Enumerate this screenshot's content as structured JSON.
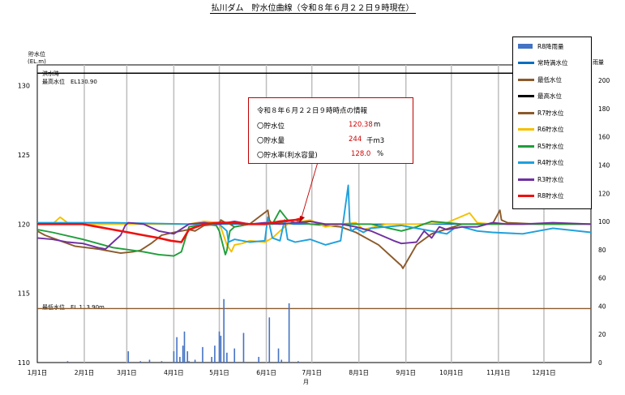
{
  "title": "払川ダム　貯水位曲線（令和８年６月２２日９時現在）",
  "axes": {
    "left_label_1": "貯水位",
    "left_label_2": "(EL.m)",
    "right_label": "雨量",
    "x_unit": "月"
  },
  "annotations": {
    "flood_label_1": "洪水時",
    "flood_label_2": "最高水位　EL130.90",
    "low_label": "最低水位　EL.113.90m"
  },
  "info_box": {
    "heading": "令和８年６月２２日９時時点の情報",
    "level_label": "〇貯水位",
    "level_value": "120.38",
    "level_unit": "m",
    "volume_label": "〇貯水量",
    "volume_value": "244",
    "volume_unit": "千m3",
    "rate_label": "〇貯水率(利水容量)",
    "rate_value": "128.0",
    "rate_unit": "%"
  },
  "legend": [
    {
      "label": "R8降雨量",
      "color": "#4472c4",
      "kind": "bar"
    },
    {
      "label": "常時満水位",
      "color": "#0070c0",
      "kind": "line"
    },
    {
      "label": "最低水位",
      "color": "#8b5a2b",
      "kind": "line"
    },
    {
      "label": "最高水位",
      "color": "#000000",
      "kind": "line"
    },
    {
      "label": "R7貯水位",
      "color": "#8b5a2b",
      "kind": "line"
    },
    {
      "label": "R6貯水位",
      "color": "#f5c000",
      "kind": "line"
    },
    {
      "label": "R5貯水位",
      "color": "#1e9e3a",
      "kind": "line"
    },
    {
      "label": "R4貯水位",
      "color": "#1ea0dc",
      "kind": "line"
    },
    {
      "label": "R3貯水位",
      "color": "#7030a0",
      "kind": "line"
    },
    {
      "label": "R8貯水位",
      "color": "#ee1010",
      "kind": "line"
    }
  ],
  "chart_data": {
    "type": "line",
    "xlabel": "月",
    "categories": [
      "1月1日",
      "2月1日",
      "3月1日",
      "4月1日",
      "5月1日",
      "6月1日",
      "7月1日",
      "8月1日",
      "9月1日",
      "10月1日",
      "11月1日",
      "12月1日"
    ],
    "y_left": {
      "label": "貯水位 (EL.m)",
      "ticks": [
        110,
        115,
        120,
        125,
        130
      ],
      "range": [
        110,
        131.5
      ]
    },
    "y_right": {
      "label": "雨量",
      "ticks": [
        0,
        20,
        40,
        60,
        80,
        100,
        120,
        140,
        160,
        180,
        200
      ],
      "range": [
        0,
        211
      ]
    },
    "grid": true,
    "legend_position": "top-right",
    "reference_lines": [
      {
        "name": "最高水位",
        "value": 130.9
      },
      {
        "name": "常時満水位",
        "value": 120.0
      },
      {
        "name": "最低水位",
        "value": 113.9
      }
    ],
    "series": [
      {
        "name": "R7貯水位",
        "x": [
          0,
          5,
          15,
          25,
          40,
          55,
          63,
          68,
          75,
          82,
          90,
          100,
          104,
          110,
          120,
          121,
          124,
          127,
          130,
          140,
          152,
          153,
          155,
          160,
          170,
          180,
          200,
          210,
          225,
          235,
          240,
          241,
          250,
          260,
          280,
          300,
          305,
          306,
          310,
          330,
          365
        ],
        "y": [
          119.5,
          119.2,
          118.8,
          118.4,
          118.2,
          117.9,
          118,
          118.1,
          118.6,
          119.2,
          119.4,
          119.6,
          119.5,
          119.9,
          120,
          120.3,
          120.1,
          120,
          119.8,
          120,
          121,
          120.3,
          120,
          120.1,
          120.3,
          120,
          119.8,
          119.4,
          118.5,
          117.5,
          117,
          116.8,
          118.5,
          119.3,
          120,
          120,
          121,
          120.3,
          120.1,
          120,
          120
        ]
      },
      {
        "name": "R6貯水位",
        "x": [
          0,
          10,
          15,
          20,
          30,
          60,
          100,
          110,
          120,
          125,
          128,
          130,
          135,
          140,
          150,
          155,
          165,
          170,
          180,
          190,
          200,
          210,
          215,
          230,
          250,
          270,
          285,
          290,
          300,
          320,
          340,
          365
        ],
        "y": [
          120,
          120,
          120.5,
          120.1,
          120,
          120,
          120,
          120.2,
          120.1,
          118.5,
          118,
          118.5,
          118.6,
          118.8,
          118.7,
          119,
          120,
          120.1,
          120.3,
          119.8,
          120,
          120.1,
          119.6,
          120,
          120,
          120.1,
          120.8,
          120.1,
          120,
          120,
          120,
          120
        ]
      },
      {
        "name": "R5貯水位",
        "x": [
          0,
          10,
          30,
          50,
          70,
          80,
          90,
          95,
          100,
          110,
          118,
          120,
          124,
          125,
          127,
          130,
          140,
          155,
          160,
          165,
          170,
          180,
          200,
          220,
          240,
          250,
          260,
          280,
          300,
          320,
          340,
          365
        ],
        "y": [
          119.6,
          119.4,
          118.9,
          118.3,
          118,
          117.8,
          117.7,
          118,
          119.8,
          120,
          119.9,
          119.5,
          117.8,
          118.1,
          119.5,
          119.8,
          120,
          120,
          121,
          120.3,
          120.1,
          120,
          120,
          120,
          119.5,
          119.8,
          120.2,
          120,
          120,
          120,
          120,
          120
        ]
      },
      {
        "name": "R4貯水位",
        "x": [
          0,
          50,
          100,
          120,
          125,
          126,
          130,
          140,
          150,
          152,
          155,
          160,
          163,
          165,
          170,
          180,
          190,
          200,
          205,
          206,
          207,
          210,
          215,
          220,
          230,
          240,
          250,
          270,
          275,
          280,
          290,
          300,
          320,
          340,
          365
        ],
        "y": [
          120.1,
          120.1,
          120,
          120,
          119.5,
          118.7,
          118.9,
          118.7,
          118.8,
          120.5,
          119,
          118.8,
          120.3,
          118.9,
          118.7,
          118.9,
          118.5,
          118.8,
          122.8,
          120,
          119.5,
          119.7,
          119.4,
          119.7,
          119.8,
          119.9,
          119.7,
          119.3,
          119.7,
          119.8,
          119.5,
          119.4,
          119.3,
          119.7,
          119.4
        ]
      },
      {
        "name": "R3貯水位",
        "x": [
          0,
          10,
          20,
          30,
          40,
          45,
          55,
          58,
          60,
          70,
          80,
          90,
          100,
          110,
          120,
          125,
          130,
          140,
          150,
          160,
          170,
          180,
          190,
          200,
          210,
          220,
          235,
          240,
          250,
          255,
          260,
          265,
          270,
          280,
          290,
          300,
          310,
          320,
          340,
          365
        ],
        "y": [
          119,
          118.9,
          118.7,
          118.6,
          118.3,
          118.2,
          119.2,
          119.9,
          120.1,
          120,
          119.5,
          119.3,
          120,
          120.1,
          120,
          120.1,
          120.2,
          120,
          120.1,
          120,
          120.1,
          120.2,
          120,
          120,
          119.8,
          119.5,
          118.8,
          118.6,
          118.7,
          119.5,
          119,
          119.8,
          119.6,
          119.8,
          119.8,
          120.1,
          120,
          120,
          120.1,
          120
        ]
      },
      {
        "name": "R8貯水位",
        "x": [
          0,
          10,
          20,
          30,
          40,
          50,
          60,
          70,
          80,
          88,
          95,
          100,
          110,
          120,
          130,
          140,
          150,
          160,
          170,
          173
        ],
        "y": [
          120,
          120,
          120,
          120,
          119.8,
          119.6,
          119.4,
          119.2,
          119,
          118.8,
          118.7,
          119.6,
          120,
          120.1,
          120.1,
          120,
          120,
          120.2,
          120.3,
          120.38
        ]
      },
      {
        "name": "R8降雨量",
        "kind": "bar",
        "x": [
          20,
          60,
          68,
          74,
          82,
          90,
          92,
          94,
          96,
          97,
          99,
          100,
          104,
          109,
          115,
          117,
          120,
          121,
          123,
          125,
          130,
          136,
          146,
          153,
          159,
          161,
          166,
          172
        ],
        "values": [
          1,
          8,
          1,
          2,
          1,
          8,
          18,
          4,
          12,
          22,
          8,
          1,
          2,
          11,
          4,
          12,
          22,
          19,
          45,
          7,
          10,
          21,
          4,
          32,
          10,
          2,
          42,
          1
        ]
      }
    ]
  }
}
